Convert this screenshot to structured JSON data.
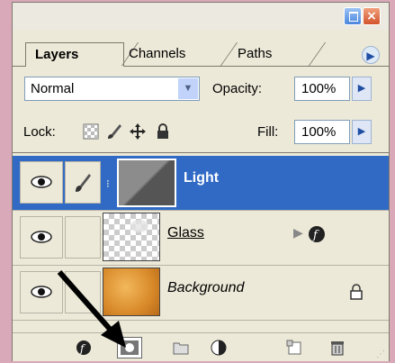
{
  "panel": {
    "tabs": [
      "Layers",
      "Channels",
      "Paths"
    ],
    "blend_mode": "Normal",
    "opacity_label": "Opacity:",
    "opacity_value": "100%",
    "lock_label": "Lock:",
    "fill_label": "Fill:",
    "fill_value": "100%"
  },
  "layers": [
    {
      "name": "Light",
      "selected": true,
      "visible": true
    },
    {
      "name": "Glass",
      "selected": false,
      "visible": true,
      "has_effects": true
    },
    {
      "name": "Background",
      "selected": false,
      "visible": true,
      "locked": true
    }
  ],
  "toolbar": {
    "icons": [
      "layer-style-icon",
      "add-mask-icon",
      "new-group-icon",
      "adjustment-layer-icon",
      "new-layer-icon",
      "trash-icon"
    ]
  },
  "colors": {
    "selection": "#316ac5",
    "page_background": "#d9a9b9"
  }
}
